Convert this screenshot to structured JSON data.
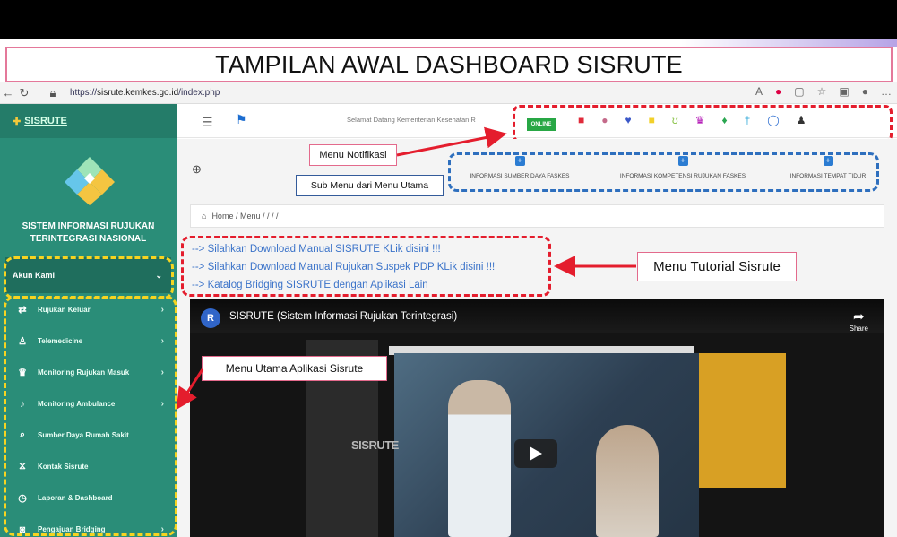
{
  "slide_title": "TAMPILAN AWAL DASHBOARD SISRUTE",
  "browser": {
    "url_prefix": "https://",
    "url_host": "sisrute.kemkes.go.id",
    "url_path": "/index.php"
  },
  "sidebar": {
    "brand": "SISRUTE",
    "system_title_line1": "SISTEM INFORMASI RUJUKAN",
    "system_title_line2": "TERINTEGRASI NASIONAL",
    "akun": "Akun Kami",
    "items": [
      {
        "label": "Rujukan Keluar",
        "icon": "referral-icon",
        "has_arrow": true
      },
      {
        "label": "Telemedicine",
        "icon": "person-icon",
        "has_arrow": true
      },
      {
        "label": "Monitoring Rujukan Masuk",
        "icon": "trophy-icon",
        "has_arrow": true
      },
      {
        "label": "Monitoring Ambulance",
        "icon": "bell-icon",
        "has_arrow": true
      },
      {
        "label": "Sumber Daya Rumah Sakit",
        "icon": "search-icon",
        "has_arrow": false
      },
      {
        "label": "Kontak Sisrute",
        "icon": "hourglass-icon",
        "has_arrow": false
      },
      {
        "label": "Laporan & Dashboard",
        "icon": "clock-icon",
        "has_arrow": false
      },
      {
        "label": "Pengajuan Bridging",
        "icon": "camera-icon",
        "has_arrow": true
      }
    ]
  },
  "topnav": {
    "welcome": "Selamat Datang Kementerian Kesehatan R",
    "status": "ONLINE"
  },
  "submenu": {
    "items": [
      "INFORMASI SUMBER DAYA FASKES",
      "INFORMASI KOMPETENSI RUJUKAN FASKES",
      "INFORMASI TEMPAT TIDUR"
    ]
  },
  "breadcrumb": "Home / Menu / / / /",
  "tutorial_links": [
    "--> Silahkan Download Manual SISRUTE KLik disini !!!",
    "--> Silahkan Download Manual Rujukan Suspek PDP KLik disini !!!",
    "--> Katalog Bridging SISRUTE dengan Aplikasi Lain"
  ],
  "video": {
    "avatar_letter": "R",
    "title": "SISRUTE (Sistem Informasi Rujukan Terintegrasi)",
    "share_label": "Share",
    "logo_text": "SISRUTE"
  },
  "annotations": {
    "menu_notifikasi": "Menu Notifikasi",
    "sub_menu": "Sub Menu dari Menu Utama",
    "menu_tutorial": "Menu Tutorial Sisrute",
    "menu_utama": "Menu Utama Aplikasi Sisrute"
  },
  "colors": {
    "sidebar": "#2a8d78",
    "annotation_red": "#e41d2d",
    "annotation_blue": "#2e6fbe",
    "annotation_yellow": "#f6d421",
    "link": "#3b73c9"
  }
}
